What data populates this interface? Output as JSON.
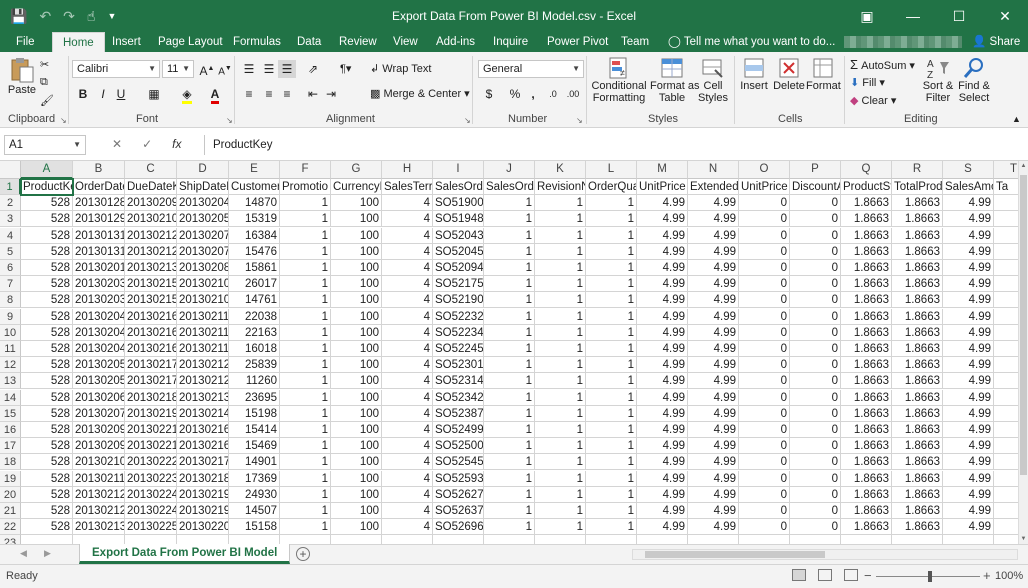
{
  "window": {
    "title": "Export Data From Power BI Model.csv - Excel",
    "qat_icons": [
      "save-icon",
      "undo-icon",
      "redo-icon",
      "touch-mode-icon",
      "customize-qat-icon"
    ],
    "controls": [
      "ribbon-display-options-icon",
      "minimize-icon",
      "maximize-icon",
      "close-icon"
    ]
  },
  "tabs": [
    "File",
    "Home",
    "Insert",
    "Page Layout",
    "Formulas",
    "Data",
    "Review",
    "View",
    "Add-ins",
    "Inquire",
    "Power Pivot",
    "Team"
  ],
  "active_tab": "Home",
  "tell_me": "Tell me what you want to do...",
  "share": "Share",
  "ribbon": {
    "clipboard": {
      "label": "Clipboard",
      "paste": "Paste"
    },
    "font": {
      "label": "Font",
      "name": "Calibri",
      "size": "11",
      "bold": "B",
      "italic": "I",
      "underline": "U"
    },
    "alignment": {
      "label": "Alignment",
      "wrap": "Wrap Text",
      "merge": "Merge & Center"
    },
    "number": {
      "label": "Number",
      "format": "General",
      "currency": "$",
      "percent": "%",
      "comma": ","
    },
    "styles": {
      "label": "Styles",
      "conditional": [
        "Conditional",
        "Formatting"
      ],
      "format_table": [
        "Format as",
        "Table"
      ],
      "cell_styles": [
        "Cell",
        "Styles"
      ]
    },
    "cells": {
      "label": "Cells",
      "insert": "Insert",
      "delete": "Delete",
      "format": "Format"
    },
    "editing": {
      "label": "Editing",
      "autosum": "AutoSum",
      "fill": "Fill",
      "clear": "Clear",
      "sort": [
        "Sort &",
        "Filter"
      ],
      "find": [
        "Find &",
        "Select"
      ]
    }
  },
  "formula_bar": {
    "name_box": "A1",
    "content": "ProductKey",
    "cancel": "✕",
    "enter": "✓",
    "fx": "fx"
  },
  "columns": [
    {
      "letter": "A",
      "header": "ProductKe",
      "align": "num"
    },
    {
      "letter": "B",
      "header": "OrderDate",
      "align": "num"
    },
    {
      "letter": "C",
      "header": "DueDateK",
      "align": "num"
    },
    {
      "letter": "D",
      "header": "ShipDateK",
      "align": "num"
    },
    {
      "letter": "E",
      "header": "Customer",
      "align": "num"
    },
    {
      "letter": "F",
      "header": "Promotio",
      "align": "num"
    },
    {
      "letter": "G",
      "header": "CurrencyK",
      "align": "num"
    },
    {
      "letter": "H",
      "header": "SalesTerri",
      "align": "num"
    },
    {
      "letter": "I",
      "header": "SalesOrde",
      "align": "txt"
    },
    {
      "letter": "J",
      "header": "SalesOrde",
      "align": "num"
    },
    {
      "letter": "K",
      "header": "RevisionN",
      "align": "num"
    },
    {
      "letter": "L",
      "header": "OrderQua",
      "align": "num"
    },
    {
      "letter": "M",
      "header": "UnitPrice",
      "align": "num"
    },
    {
      "letter": "N",
      "header": "Extended",
      "align": "num"
    },
    {
      "letter": "O",
      "header": "UnitPrice",
      "align": "num"
    },
    {
      "letter": "P",
      "header": "DiscountA",
      "align": "num"
    },
    {
      "letter": "Q",
      "header": "ProductSt",
      "align": "num"
    },
    {
      "letter": "R",
      "header": "TotalProd",
      "align": "num"
    },
    {
      "letter": "S",
      "header": "SalesAmo",
      "align": "num"
    },
    {
      "letter": "T",
      "header": "Ta",
      "align": "txt"
    }
  ],
  "rows": [
    [
      "528",
      "20130128",
      "20130209",
      "20130204",
      "14870",
      "1",
      "100",
      "4",
      "SO51900",
      "1",
      "1",
      "1",
      "4.99",
      "4.99",
      "0",
      "0",
      "1.8663",
      "1.8663",
      "4.99",
      ""
    ],
    [
      "528",
      "20130129",
      "20130210",
      "20130205",
      "15319",
      "1",
      "100",
      "4",
      "SO51948",
      "1",
      "1",
      "1",
      "4.99",
      "4.99",
      "0",
      "0",
      "1.8663",
      "1.8663",
      "4.99",
      ""
    ],
    [
      "528",
      "20130131",
      "20130212",
      "20130207",
      "16384",
      "1",
      "100",
      "4",
      "SO52043",
      "1",
      "1",
      "1",
      "4.99",
      "4.99",
      "0",
      "0",
      "1.8663",
      "1.8663",
      "4.99",
      ""
    ],
    [
      "528",
      "20130131",
      "20130212",
      "20130207",
      "15476",
      "1",
      "100",
      "4",
      "SO52045",
      "1",
      "1",
      "1",
      "4.99",
      "4.99",
      "0",
      "0",
      "1.8663",
      "1.8663",
      "4.99",
      ""
    ],
    [
      "528",
      "20130201",
      "20130213",
      "20130208",
      "15861",
      "1",
      "100",
      "4",
      "SO52094",
      "1",
      "1",
      "1",
      "4.99",
      "4.99",
      "0",
      "0",
      "1.8663",
      "1.8663",
      "4.99",
      ""
    ],
    [
      "528",
      "20130203",
      "20130215",
      "20130210",
      "26017",
      "1",
      "100",
      "4",
      "SO52175",
      "1",
      "1",
      "1",
      "4.99",
      "4.99",
      "0",
      "0",
      "1.8663",
      "1.8663",
      "4.99",
      ""
    ],
    [
      "528",
      "20130203",
      "20130215",
      "20130210",
      "14761",
      "1",
      "100",
      "4",
      "SO52190",
      "1",
      "1",
      "1",
      "4.99",
      "4.99",
      "0",
      "0",
      "1.8663",
      "1.8663",
      "4.99",
      ""
    ],
    [
      "528",
      "20130204",
      "20130216",
      "20130211",
      "22038",
      "1",
      "100",
      "4",
      "SO52232",
      "1",
      "1",
      "1",
      "4.99",
      "4.99",
      "0",
      "0",
      "1.8663",
      "1.8663",
      "4.99",
      ""
    ],
    [
      "528",
      "20130204",
      "20130216",
      "20130211",
      "22163",
      "1",
      "100",
      "4",
      "SO52234",
      "1",
      "1",
      "1",
      "4.99",
      "4.99",
      "0",
      "0",
      "1.8663",
      "1.8663",
      "4.99",
      ""
    ],
    [
      "528",
      "20130204",
      "20130216",
      "20130211",
      "16018",
      "1",
      "100",
      "4",
      "SO52245",
      "1",
      "1",
      "1",
      "4.99",
      "4.99",
      "0",
      "0",
      "1.8663",
      "1.8663",
      "4.99",
      ""
    ],
    [
      "528",
      "20130205",
      "20130217",
      "20130212",
      "25839",
      "1",
      "100",
      "4",
      "SO52301",
      "1",
      "1",
      "1",
      "4.99",
      "4.99",
      "0",
      "0",
      "1.8663",
      "1.8663",
      "4.99",
      ""
    ],
    [
      "528",
      "20130205",
      "20130217",
      "20130212",
      "11260",
      "1",
      "100",
      "4",
      "SO52314",
      "1",
      "1",
      "1",
      "4.99",
      "4.99",
      "0",
      "0",
      "1.8663",
      "1.8663",
      "4.99",
      ""
    ],
    [
      "528",
      "20130206",
      "20130218",
      "20130213",
      "23695",
      "1",
      "100",
      "4",
      "SO52342",
      "1",
      "1",
      "1",
      "4.99",
      "4.99",
      "0",
      "0",
      "1.8663",
      "1.8663",
      "4.99",
      ""
    ],
    [
      "528",
      "20130207",
      "20130219",
      "20130214",
      "15198",
      "1",
      "100",
      "4",
      "SO52387",
      "1",
      "1",
      "1",
      "4.99",
      "4.99",
      "0",
      "0",
      "1.8663",
      "1.8663",
      "4.99",
      ""
    ],
    [
      "528",
      "20130209",
      "20130221",
      "20130216",
      "15414",
      "1",
      "100",
      "4",
      "SO52499",
      "1",
      "1",
      "1",
      "4.99",
      "4.99",
      "0",
      "0",
      "1.8663",
      "1.8663",
      "4.99",
      ""
    ],
    [
      "528",
      "20130209",
      "20130221",
      "20130216",
      "15469",
      "1",
      "100",
      "4",
      "SO52500",
      "1",
      "1",
      "1",
      "4.99",
      "4.99",
      "0",
      "0",
      "1.8663",
      "1.8663",
      "4.99",
      ""
    ],
    [
      "528",
      "20130210",
      "20130222",
      "20130217",
      "14901",
      "1",
      "100",
      "4",
      "SO52545",
      "1",
      "1",
      "1",
      "4.99",
      "4.99",
      "0",
      "0",
      "1.8663",
      "1.8663",
      "4.99",
      ""
    ],
    [
      "528",
      "20130211",
      "20130223",
      "20130218",
      "17369",
      "1",
      "100",
      "4",
      "SO52593",
      "1",
      "1",
      "1",
      "4.99",
      "4.99",
      "0",
      "0",
      "1.8663",
      "1.8663",
      "4.99",
      ""
    ],
    [
      "528",
      "20130212",
      "20130224",
      "20130219",
      "24930",
      "1",
      "100",
      "4",
      "SO52627",
      "1",
      "1",
      "1",
      "4.99",
      "4.99",
      "0",
      "0",
      "1.8663",
      "1.8663",
      "4.99",
      ""
    ],
    [
      "528",
      "20130212",
      "20130224",
      "20130219",
      "14507",
      "1",
      "100",
      "4",
      "SO52637",
      "1",
      "1",
      "1",
      "4.99",
      "4.99",
      "0",
      "0",
      "1.8663",
      "1.8663",
      "4.99",
      ""
    ],
    [
      "528",
      "20130213",
      "20130225",
      "20130220",
      "15158",
      "1",
      "100",
      "4",
      "SO52696",
      "1",
      "1",
      "1",
      "4.99",
      "4.99",
      "0",
      "0",
      "1.8663",
      "1.8663",
      "4.99",
      ""
    ]
  ],
  "sheet_tab": "Export Data From Power BI Model",
  "status": {
    "ready": "Ready",
    "zoom": "100%"
  },
  "colors": {
    "excel_green": "#217346",
    "ribbon_bg": "#f3f3f3",
    "grid_line": "#d4d4d4"
  }
}
